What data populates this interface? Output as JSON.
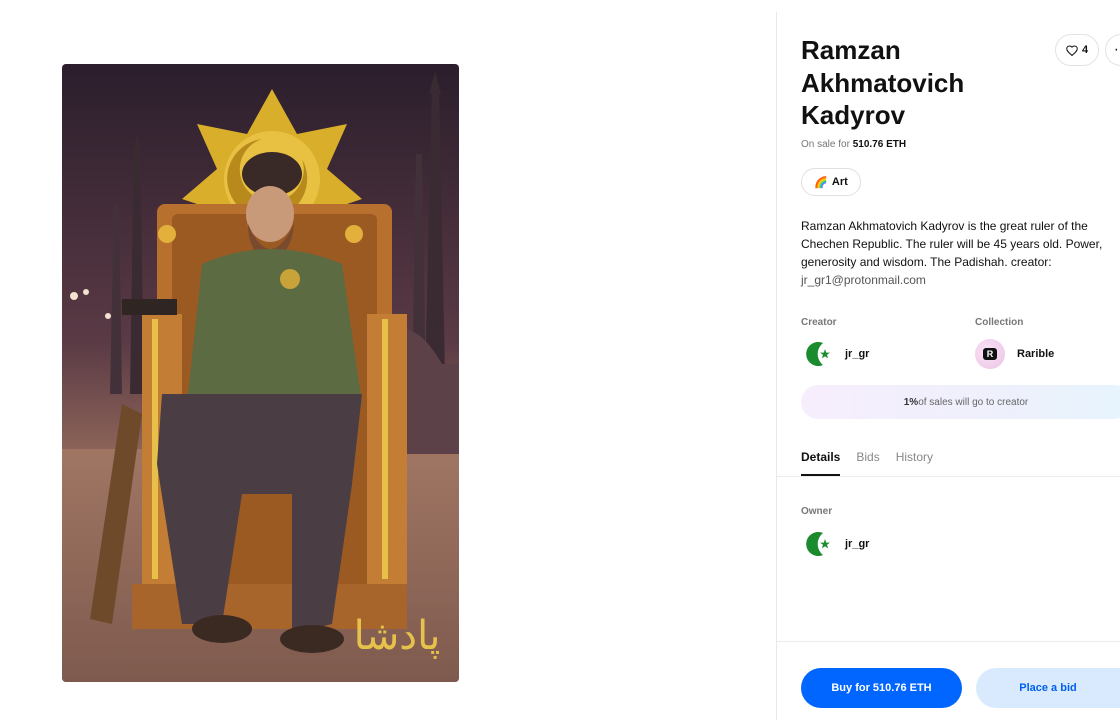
{
  "nft": {
    "title": "Ramzan Akhmatovich Kadyrov",
    "sale_prefix": "On sale for",
    "price": "510.76 ETH",
    "likes": "4",
    "more_glyph": "⋯",
    "tag": {
      "emoji": "🌈",
      "label": "Art"
    },
    "description": "Ramzan Akhmatovich Kadyrov is the great ruler of the Chechen Republic. The ruler will be 45 years old. Power, generosity and wisdom. The Padishah. creator:",
    "email": "jr_gr1@protonmail.com",
    "artwork_caption": "پادشا"
  },
  "creator": {
    "label": "Creator",
    "name": "jr_gr"
  },
  "collection": {
    "label": "Collection",
    "name": "Rarible",
    "logo_letter": "R"
  },
  "royalty": {
    "pct": "1%",
    "text": " of sales will go to creator"
  },
  "tabs": [
    {
      "label": "Details"
    },
    {
      "label": "Bids"
    },
    {
      "label": "History"
    }
  ],
  "owner": {
    "label": "Owner",
    "name": "jr_gr"
  },
  "actions": {
    "buy": "Buy for 510.76 ETH",
    "bid": "Place a bid"
  },
  "colors": {
    "accent": "#0066ff",
    "bid_bg": "#d9eaff",
    "crescent": "#1a8c2e"
  }
}
